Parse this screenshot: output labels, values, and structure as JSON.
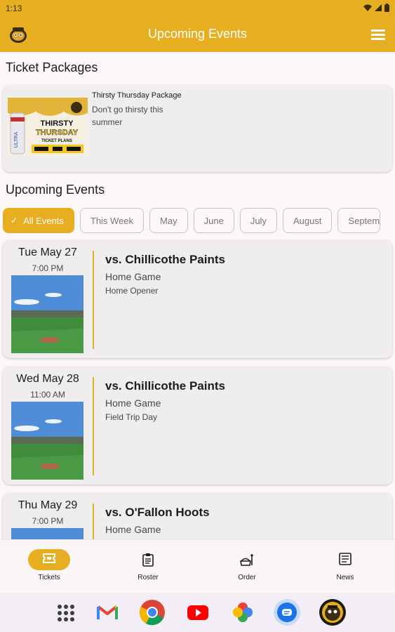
{
  "status": {
    "time": "1:13"
  },
  "appbar": {
    "title": "Upcoming Events"
  },
  "packages": {
    "section_title": "Ticket Packages",
    "items": [
      {
        "name": "Thirsty Thursday Package",
        "description": "Don't go thirsty this summer",
        "image_text": [
          "THIRSTY",
          "THURSDAY",
          "TICKET PLANS"
        ]
      }
    ]
  },
  "events": {
    "section_title": "Upcoming Events",
    "filters": [
      "All Events",
      "This Week",
      "May",
      "June",
      "July",
      "August",
      "Septem"
    ],
    "active_filter": "All Events",
    "items": [
      {
        "date": "Tue May 27",
        "time": "7:00 PM",
        "opponent": "vs. Chillicothe Paints",
        "type": "Home Game",
        "note": "Home Opener"
      },
      {
        "date": "Wed May 28",
        "time": "11:00 AM",
        "opponent": "vs. Chillicothe Paints",
        "type": "Home Game",
        "note": "Field Trip Day"
      },
      {
        "date": "Thu May 29",
        "time": "7:00 PM",
        "opponent": "vs. O'Fallon Hoots",
        "type": "Home Game",
        "note": ""
      }
    ]
  },
  "bottom_nav": {
    "items": [
      {
        "label": "Tickets",
        "icon": "ticket-icon",
        "active": true
      },
      {
        "label": "Roster",
        "icon": "clipboard-icon",
        "active": false
      },
      {
        "label": "Order",
        "icon": "food-order-icon",
        "active": false
      },
      {
        "label": "News",
        "icon": "newspaper-icon",
        "active": false
      }
    ]
  },
  "dock": {
    "apps": [
      "app-drawer-icon",
      "gmail-icon",
      "chrome-icon",
      "youtube-icon",
      "photos-icon",
      "messages-icon",
      "team-app-icon"
    ]
  },
  "colors": {
    "accent": "#e6ae20",
    "background": "#fdf8f8",
    "card": "#efeded"
  }
}
